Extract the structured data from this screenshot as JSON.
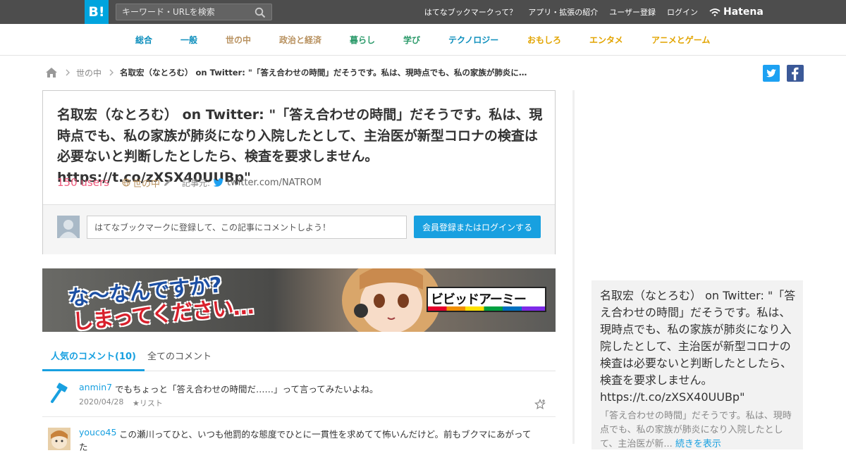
{
  "topbar": {
    "logo": "B!",
    "search_placeholder": "キーワード・URLを検索",
    "links": [
      "はてなブックマークって？",
      "アプリ・拡張の紹介",
      "ユーザー登録",
      "ログイン"
    ],
    "brand": "Hatena"
  },
  "categories": [
    {
      "label": "総合",
      "color": "#0e8fbd"
    },
    {
      "label": "一般",
      "color": "#0e8fbd"
    },
    {
      "label": "世の中",
      "color": "#b8915f"
    },
    {
      "label": "政治と経済",
      "color": "#b8915f"
    },
    {
      "label": "暮らし",
      "color": "#2b9a6a"
    },
    {
      "label": "学び",
      "color": "#2b9a6a"
    },
    {
      "label": "テクノロジー",
      "color": "#0e8fbd"
    },
    {
      "label": "おもしろ",
      "color": "#e2a400"
    },
    {
      "label": "エンタメ",
      "color": "#e2a400"
    },
    {
      "label": "アニメとゲーム",
      "color": "#e2a400"
    }
  ],
  "breadcrumb": {
    "category": "世の中",
    "title": "名取宏（なとろむ） on Twitter: \"「答え合わせの時間」だそうです。私は、現時点でも、私の家族が肺炎に…"
  },
  "entry": {
    "title": "名取宏（なとろむ） on Twitter: \"「答え合わせの時間」だそうです。私は、現時点でも、私の家族が肺炎になり入院したとして、主治医が新型コロナの検査は必要ないと判断したとしたら、検査を要求しません。 https://t.co/zXSX40UUBp\"",
    "users": "150 users",
    "category": "世の中",
    "source_label": "記事元:",
    "source": "twitter.com/NATROM",
    "comment_placeholder": "はてなブックマークに登録して、この記事にコメントしよう！",
    "login_button": "会員登録またはログインする"
  },
  "ad": {
    "line1": "な〜なんですか?",
    "line2": "しまってください…",
    "logo_text": "ビビッドアーミー"
  },
  "tabs": {
    "popular": "人気のコメント(10)",
    "all": "全てのコメント"
  },
  "comments": [
    {
      "user": "anmin7",
      "text": "でもちょっと「答え合わせの時間だ……」って言ってみたいよね。",
      "date": "2020/04/28",
      "list": "★リスト"
    },
    {
      "user": "youco45",
      "text": "この瀬川ってひと、いつも他罰的な態度でひとに一貫性を求めてて怖いんだけど。前もブクマにあがって",
      "cont": "た"
    }
  ],
  "sidebar": {
    "title": "名取宏（なとろむ） on Twitter: \"「答え合わせの時間」だそうです。私は、現時点でも、私の家族が肺炎になり入院したとして、主治医が新型コロナの検査は必要ないと判断したとしたら、検査を要求しません。 https://t.co/zXSX40UUBp\"",
    "desc": "「答え合わせの時間」だそうです。私は、現時点でも、私の家族が肺炎になり入院したとして、主治医が新...",
    "more": "続きを表示"
  },
  "colors": {
    "topbar": "#4d4d4d",
    "brand_blue": "#00a4de",
    "users_pink": "#ee5a7d",
    "link_blue": "#18a0e0"
  }
}
